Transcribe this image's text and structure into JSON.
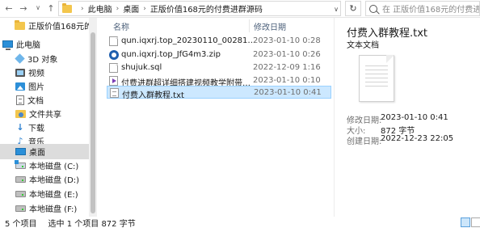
{
  "address_bar": {
    "segments": [
      "此电脑",
      "桌面",
      "正版价值168元的付费进群源码"
    ],
    "search_placeholder": "在 正版价值168元的付费进..."
  },
  "nav_pane": {
    "items": [
      {
        "label": "正版价值168元的付费进",
        "icon": "folder-icon"
      },
      {
        "label": "此电脑",
        "icon": "computer-icon"
      },
      {
        "label": "3D 对象",
        "icon": "3d-objects-icon"
      },
      {
        "label": "视频",
        "icon": "video-icon"
      },
      {
        "label": "图片",
        "icon": "pictures-icon"
      },
      {
        "label": "文档",
        "icon": "documents-icon"
      },
      {
        "label": "文件共享",
        "icon": "shared-folder-icon"
      },
      {
        "label": "下载",
        "icon": "download-icon"
      },
      {
        "label": "音乐",
        "icon": "music-icon"
      },
      {
        "label": "桌面",
        "icon": "desktop-icon",
        "selected": true
      },
      {
        "label": "本地磁盘 (C:)",
        "icon": "drive-c-icon"
      },
      {
        "label": "本地磁盘 (D:)",
        "icon": "drive-icon"
      },
      {
        "label": "本地磁盘 (E:)",
        "icon": "drive-icon"
      },
      {
        "label": "本地磁盘 (F:)",
        "icon": "drive-icon"
      }
    ]
  },
  "file_list": {
    "columns": {
      "name": "名称",
      "date": "修改日期"
    },
    "files": [
      {
        "name": "qun.iqxrj.top_20230110_002810.sql",
        "date": "2023-01-10 0:28",
        "icon": "sql-file-icon"
      },
      {
        "name": "qun.iqxrj.top_JfG4m3.zip",
        "date": "2023-01-10 0:26",
        "icon": "zip-file-icon"
      },
      {
        "name": "shujuk.sql",
        "date": "2022-12-09 1:16",
        "icon": "sql-file-icon"
      },
      {
        "name": "付费进群超详细搭建视频教学附带源码,...",
        "date": "2023-01-10 0:10",
        "icon": "video-file-icon"
      },
      {
        "name": "付费入群教程.txt",
        "date": "2023-01-10 0:41",
        "icon": "text-file-icon",
        "selected": true
      }
    ]
  },
  "preview": {
    "title": "付费入群教程.txt",
    "type": "文本文档",
    "properties": [
      {
        "label": "修改日期:",
        "value": "2023-01-10 0:41"
      },
      {
        "label": "大小:",
        "value": "872 字节"
      },
      {
        "label": "创建日期:",
        "value": "2022-12-23 22:05"
      }
    ]
  },
  "status_bar": {
    "item_count": "5 个项目",
    "selection": "选中 1 个项目  872 字节"
  }
}
